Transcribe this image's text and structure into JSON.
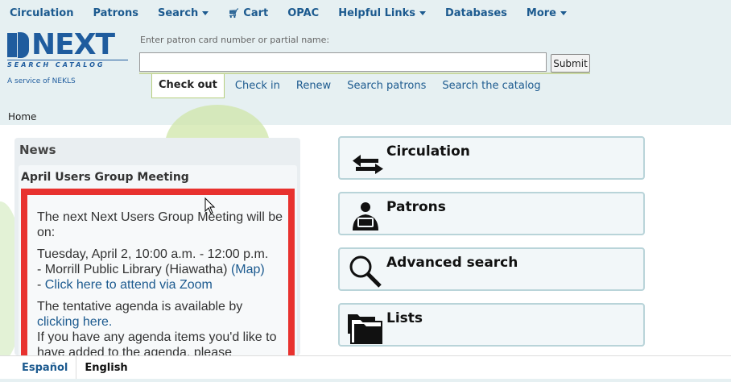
{
  "topnav": {
    "items": [
      {
        "label": "Circulation",
        "dropdown": false
      },
      {
        "label": "Patrons",
        "dropdown": false
      },
      {
        "label": "Search",
        "dropdown": true
      },
      {
        "label": "Cart",
        "dropdown": false,
        "icon": "cart-icon"
      },
      {
        "label": "OPAC",
        "dropdown": false
      },
      {
        "label": "Helpful Links",
        "dropdown": true
      },
      {
        "label": "Databases",
        "dropdown": false
      },
      {
        "label": "More",
        "dropdown": true
      }
    ]
  },
  "logo": {
    "word": "NEXT",
    "subtitle": "SEARCH CATALOG",
    "service": "A service of NEKLS"
  },
  "checkout": {
    "label": "Enter patron card number or partial name:",
    "input_value": "",
    "submit_label": "Submit"
  },
  "tabs": [
    {
      "label": "Check out",
      "active": true
    },
    {
      "label": "Check in",
      "active": false
    },
    {
      "label": "Renew",
      "active": false
    },
    {
      "label": "Search patrons",
      "active": false
    },
    {
      "label": "Search the catalog",
      "active": false
    }
  ],
  "breadcrumb": {
    "home": "Home"
  },
  "news": {
    "title": "News",
    "item_title": "April Users Group Meeting",
    "p1": "The next Next Users Group Meeting will be on:",
    "p2_line1": "Tuesday, April 2, 10:00 a.m. - 12:00 p.m.",
    "p2_line2a": "- Morrill Public Library (Hiawatha) ",
    "p2_map": "(Map)",
    "p2_line3a": "- ",
    "p2_zoom": "Click here to attend via Zoom",
    "p3a": "The tentative agenda is available by ",
    "p3_link": "clicking here.",
    "p4": "If you have any agenda items you'd like to have added to the agenda, please"
  },
  "panels": [
    {
      "label": "Circulation",
      "icon": "circulation-arrows-icon"
    },
    {
      "label": "Patrons",
      "icon": "patron-icon"
    },
    {
      "label": "Advanced search",
      "icon": "magnifier-icon"
    },
    {
      "label": "Lists",
      "icon": "folders-icon"
    }
  ],
  "footer": {
    "lang_link": "Español",
    "lang_current": "English"
  },
  "colors": {
    "link": "#1c5a8f",
    "header_bg": "#e6f0f2",
    "news_border": "#e8322f",
    "panel_border": "#b9d4d9"
  }
}
